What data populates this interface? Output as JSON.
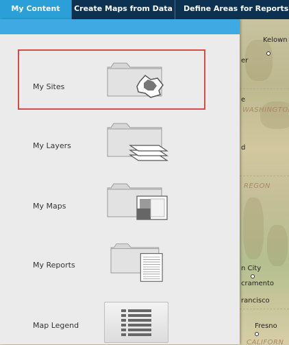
{
  "tabs": [
    {
      "label": "My Content",
      "active": true
    },
    {
      "label": "Create Maps from Data",
      "active": false
    },
    {
      "label": "Define Areas for Reports",
      "active": false
    }
  ],
  "panel": {
    "items": [
      {
        "label": "My Sites",
        "icon": "folder-sites-icon",
        "selected": true
      },
      {
        "label": "My Layers",
        "icon": "folder-layers-icon",
        "selected": false
      },
      {
        "label": "My Maps",
        "icon": "folder-maps-icon",
        "selected": false
      },
      {
        "label": "My Reports",
        "icon": "folder-reports-icon",
        "selected": false
      },
      {
        "label": "Map Legend",
        "icon": "legend-icon",
        "selected": false
      }
    ]
  },
  "map": {
    "labels": [
      "Kelown",
      "er",
      "e",
      "WASHINGTON",
      "d",
      "REGON",
      "n City",
      "cramento",
      "rancisco",
      "Fresno",
      "CALIFORN"
    ]
  },
  "colors": {
    "tabbar": "#0d3150",
    "tab_active": "#2a9fd8",
    "panel_strip": "#3daae3",
    "panel_bg": "#ebebeb",
    "selection": "#d64a46"
  }
}
